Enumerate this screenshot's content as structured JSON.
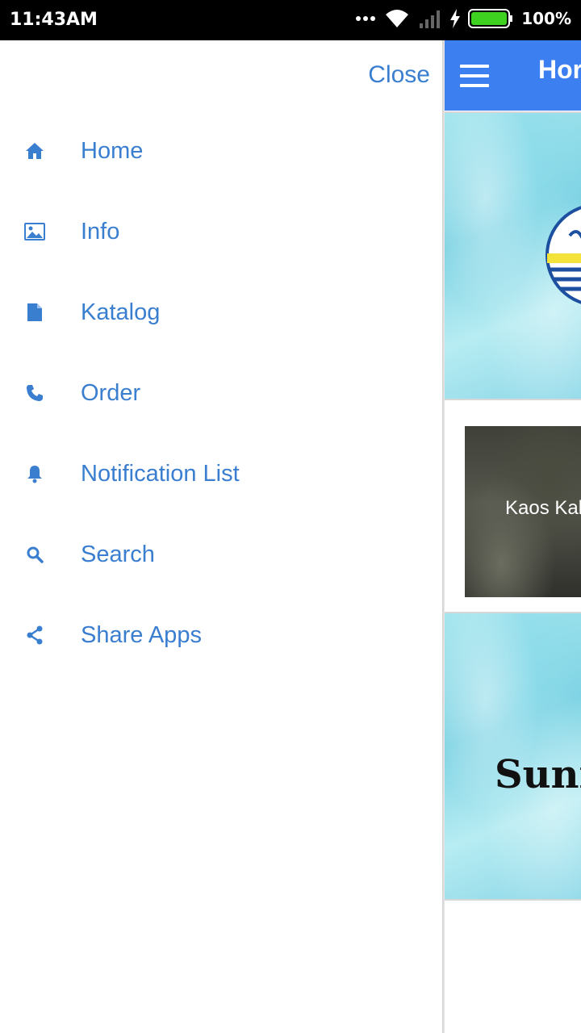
{
  "status_bar": {
    "time": "11:43AM",
    "battery": "100%",
    "icons": [
      "more-dots-icon",
      "wifi-icon",
      "signal-icon",
      "charging-icon",
      "battery-icon"
    ]
  },
  "drawer": {
    "close_label": "Close",
    "accent_color": "#3a7ed0",
    "items": [
      {
        "label": "Home",
        "icon": "home-icon"
      },
      {
        "label": "Info",
        "icon": "image-icon"
      },
      {
        "label": "Katalog",
        "icon": "document-icon"
      },
      {
        "label": "Order",
        "icon": "phone-icon"
      },
      {
        "label": "Notification List",
        "icon": "bell-icon"
      },
      {
        "label": "Search",
        "icon": "search-icon"
      },
      {
        "label": "Share Apps",
        "icon": "share-icon"
      }
    ]
  },
  "main": {
    "app_bar_color": "#3b7ff0",
    "title": "Hor",
    "card_caption": "Kaos Kak",
    "banner_text": "Sunn"
  }
}
